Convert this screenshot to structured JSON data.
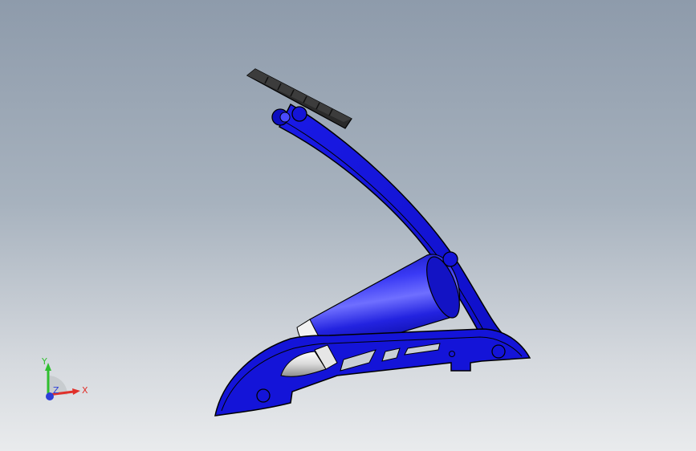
{
  "triad": {
    "x_label": "X",
    "y_label": "Y",
    "z_label": "Z",
    "x_color": "#e0302a",
    "y_color": "#2fbf2f",
    "z_color": "#2d3fd8"
  },
  "model": {
    "body_color": "#1414d8",
    "cylinder_color": "#2323e6",
    "pedal_color": "#2a2a2a",
    "piston_color": "#e8e8e8"
  }
}
